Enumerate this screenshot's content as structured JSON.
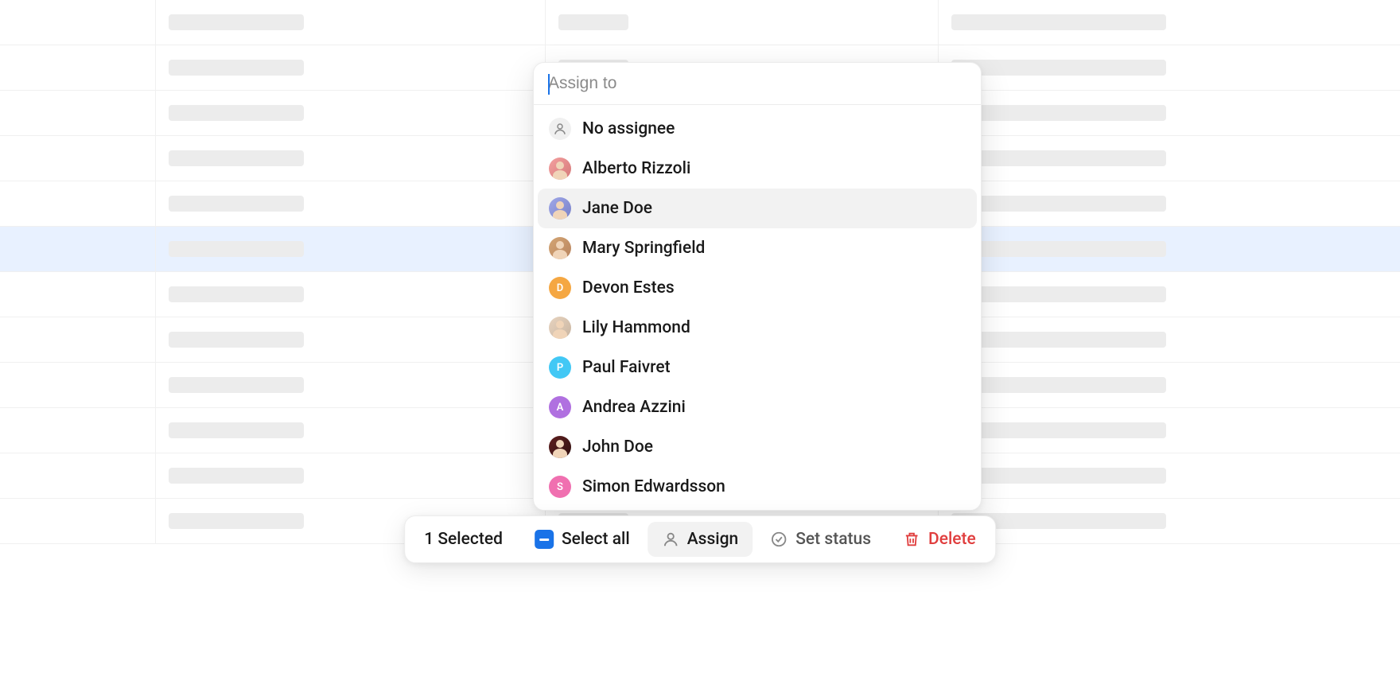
{
  "dropdown": {
    "placeholder": "Assign to",
    "items": [
      {
        "label": "No assignee",
        "type": "none"
      },
      {
        "label": "Alberto Rizzoli",
        "type": "photo",
        "bg1": "#f4a0a0",
        "bg2": "#d47878"
      },
      {
        "label": "Jane Doe",
        "type": "photo",
        "bg1": "#a0a8e8",
        "bg2": "#7880c8",
        "hovered": true
      },
      {
        "label": "Mary Springfield",
        "type": "photo",
        "bg1": "#d4a574",
        "bg2": "#b8845f"
      },
      {
        "label": "Devon Estes",
        "type": "initial",
        "initial": "D",
        "color": "#f5a742"
      },
      {
        "label": "Lily Hammond",
        "type": "photo",
        "bg1": "#e8d4c0",
        "bg2": "#c8b4a0"
      },
      {
        "label": "Paul Faivret",
        "type": "initial",
        "initial": "P",
        "color": "#42c8f5"
      },
      {
        "label": "Andrea Azzini",
        "type": "initial",
        "initial": "A",
        "color": "#b070e0"
      },
      {
        "label": "John Doe",
        "type": "photo",
        "bg1": "#602020",
        "bg2": "#301010"
      },
      {
        "label": "Simon Edwardsson",
        "type": "initial",
        "initial": "S",
        "color": "#f070b0"
      }
    ]
  },
  "toolbar": {
    "selected_count": "1 Selected",
    "select_all": "Select all",
    "assign": "Assign",
    "set_status": "Set status",
    "delete": "Delete"
  },
  "table": {
    "rows": 12,
    "selected_index": 5
  }
}
